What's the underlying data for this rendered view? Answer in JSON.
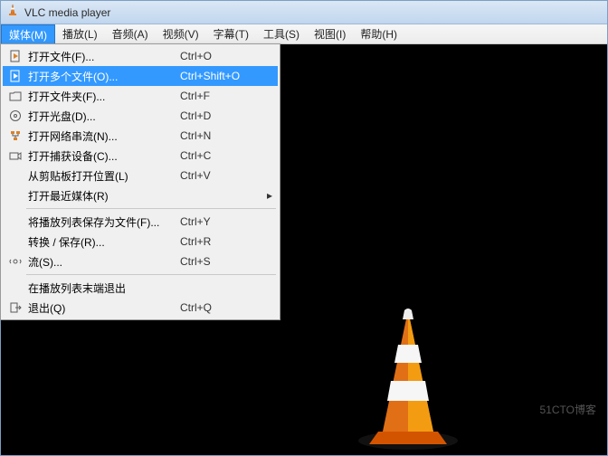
{
  "title": "VLC media player",
  "menubar": [
    "媒体(M)",
    "播放(L)",
    "音频(A)",
    "视频(V)",
    "字幕(T)",
    "工具(S)",
    "视图(I)",
    "帮助(H)"
  ],
  "dropdown": {
    "items": [
      {
        "icon": "file-play",
        "label": "打开文件(F)...",
        "shortcut": "Ctrl+O",
        "highlight": false
      },
      {
        "icon": "file-play",
        "label": "打开多个文件(O)...",
        "shortcut": "Ctrl+Shift+O",
        "highlight": true
      },
      {
        "icon": "folder",
        "label": "打开文件夹(F)...",
        "shortcut": "Ctrl+F",
        "highlight": false
      },
      {
        "icon": "disc",
        "label": "打开光盘(D)...",
        "shortcut": "Ctrl+D",
        "highlight": false
      },
      {
        "icon": "network",
        "label": "打开网络串流(N)...",
        "shortcut": "Ctrl+N",
        "highlight": false
      },
      {
        "icon": "capture",
        "label": "打开捕获设备(C)...",
        "shortcut": "Ctrl+C",
        "highlight": false
      },
      {
        "icon": "",
        "label": "从剪贴板打开位置(L)",
        "shortcut": "Ctrl+V",
        "highlight": false
      },
      {
        "icon": "",
        "label": "打开最近媒体(R)",
        "shortcut": "",
        "submenu": true,
        "highlight": false
      },
      {
        "sep": true
      },
      {
        "icon": "",
        "label": "将播放列表保存为文件(F)...",
        "shortcut": "Ctrl+Y",
        "highlight": false
      },
      {
        "icon": "",
        "label": "转换 / 保存(R)...",
        "shortcut": "Ctrl+R",
        "highlight": false
      },
      {
        "icon": "stream",
        "label": "流(S)...",
        "shortcut": "Ctrl+S",
        "highlight": false
      },
      {
        "sep": true
      },
      {
        "icon": "",
        "label": "在播放列表末端退出",
        "shortcut": "",
        "highlight": false
      },
      {
        "icon": "quit",
        "label": "退出(Q)",
        "shortcut": "Ctrl+Q",
        "highlight": false
      }
    ]
  },
  "watermark": "51CTO博客"
}
